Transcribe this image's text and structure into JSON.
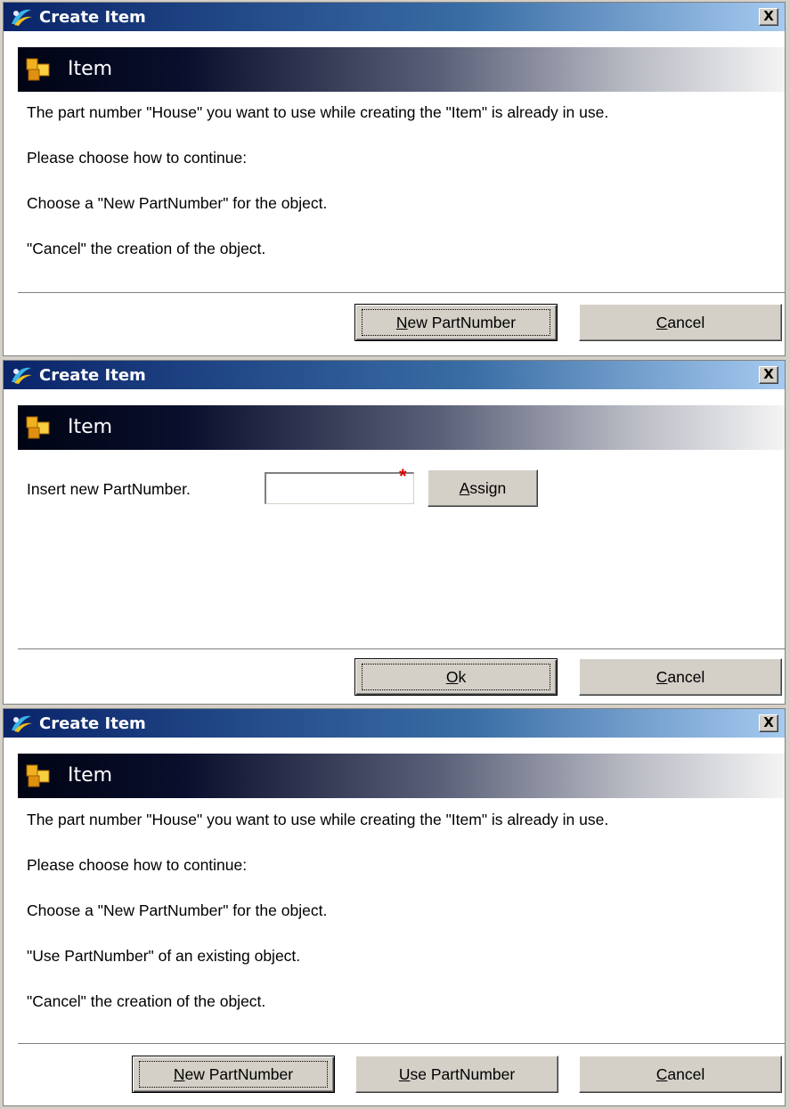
{
  "dialogs": [
    {
      "title": "Create Item",
      "header": "Item",
      "messages": [
        "The part number \"House\" you want to use while creating the \"Item\" is already in use.",
        "Please choose how to continue:",
        "Choose a \"New PartNumber\" for the object.",
        "\"Cancel\" the creation of the object."
      ],
      "buttons": {
        "new_partnumber": {
          "before": "",
          "key": "N",
          "after": "ew PartNumber"
        },
        "cancel": {
          "before": "",
          "key": "C",
          "after": "ancel"
        }
      }
    },
    {
      "title": "Create Item",
      "header": "Item",
      "field_label": "Insert new PartNumber.",
      "field_value": "",
      "required_marker": "*",
      "buttons": {
        "assign": {
          "before": "",
          "key": "A",
          "after": "ssign"
        },
        "ok": {
          "before": "",
          "key": "O",
          "after": "k"
        },
        "cancel": {
          "before": "",
          "key": "C",
          "after": "ancel"
        }
      }
    },
    {
      "title": "Create Item",
      "header": "Item",
      "messages": [
        "The part number \"House\" you want to use while creating the \"Item\" is already in use.",
        "Please choose how to continue:",
        "Choose a \"New PartNumber\" for the object.",
        "\"Use PartNumber\" of an existing object.",
        "\"Cancel\" the creation of the object."
      ],
      "buttons": {
        "new_partnumber": {
          "before": "",
          "key": "N",
          "after": "ew PartNumber"
        },
        "use_partnumber": {
          "before": "",
          "key": "U",
          "after": "se PartNumber"
        },
        "cancel": {
          "before": "",
          "key": "C",
          "after": "ancel"
        }
      }
    }
  ],
  "close_glyph": "X",
  "icons": {
    "app": "app-logo-icon",
    "item": "item-cubes-icon",
    "close": "close-icon"
  },
  "colors": {
    "titlebar_start": "#0a246a",
    "titlebar_end": "#a6caf0",
    "required": "#e00000",
    "button_face": "#d4d0c8"
  }
}
